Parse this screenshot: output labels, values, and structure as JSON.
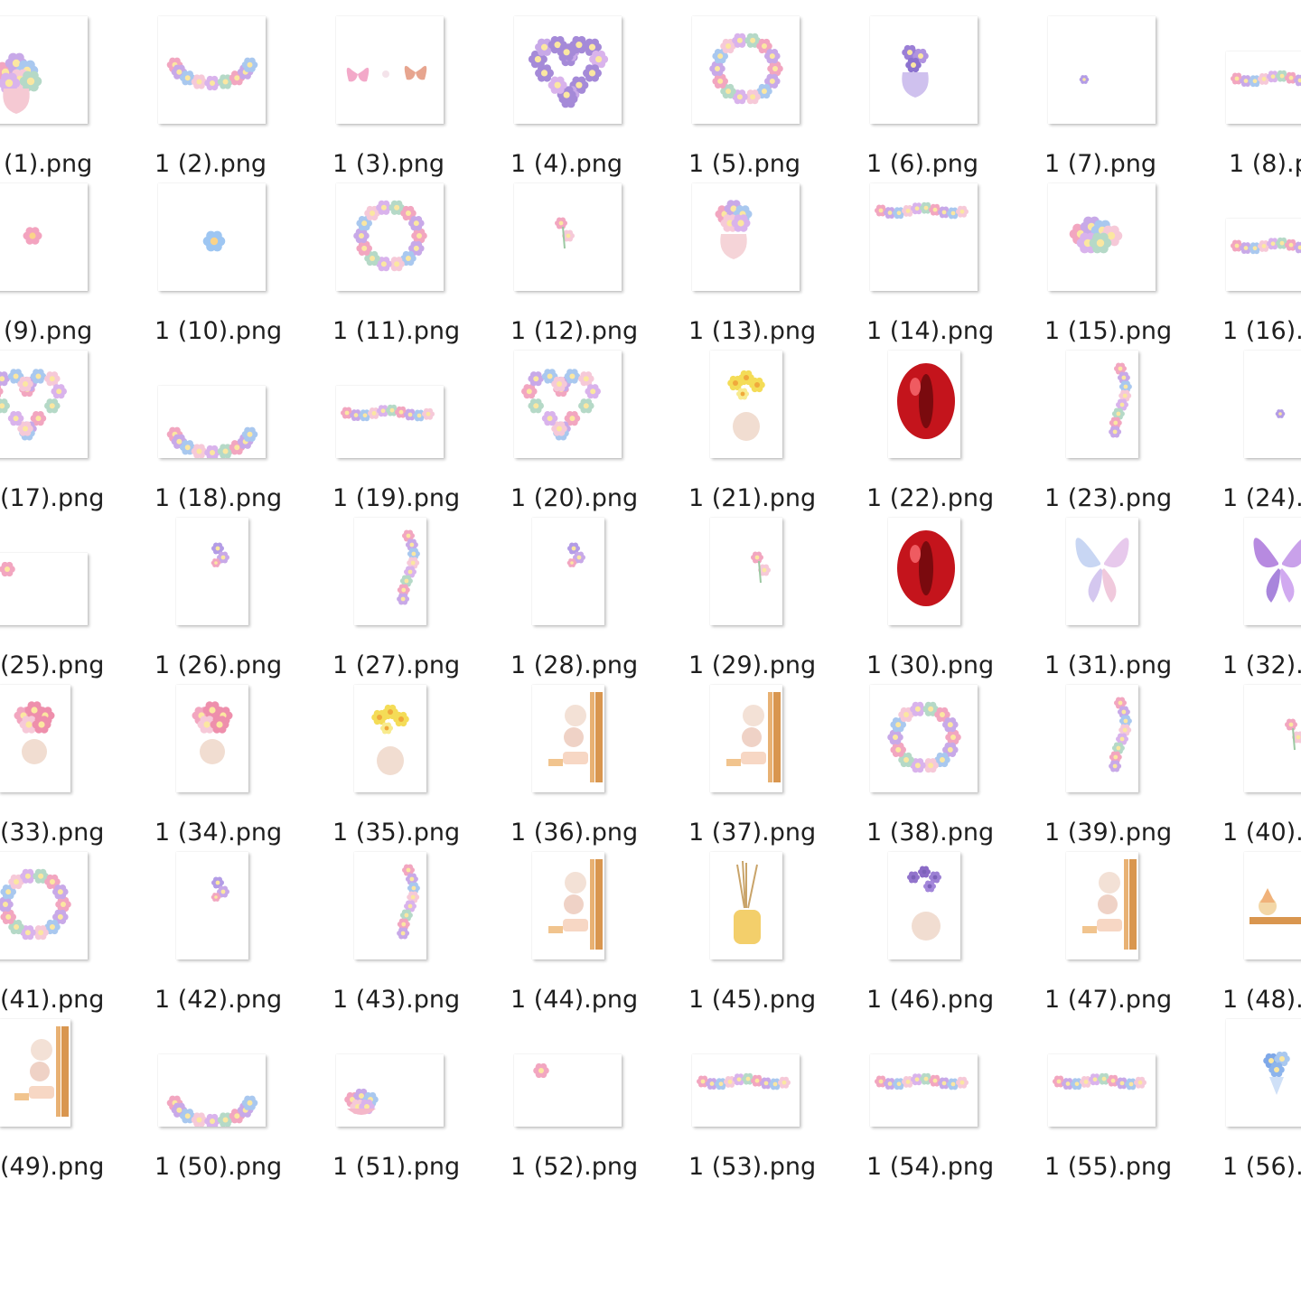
{
  "window": {
    "view": "large-icons"
  },
  "files": [
    {
      "label": "(1).png",
      "icon": "rose-bouquet-icon"
    },
    {
      "label": "1 (2).png",
      "icon": "floral-arc-icon"
    },
    {
      "label": "1 (3).png",
      "icon": "butterflies-icon"
    },
    {
      "label": "1 (4).png",
      "icon": "purple-heart-wreath-icon"
    },
    {
      "label": "1 (5).png",
      "icon": "floral-ring-icon"
    },
    {
      "label": "1 (6).png",
      "icon": "purple-bouquet-icon"
    },
    {
      "label": "1 (7).png",
      "icon": "tiny-flower-icon"
    },
    {
      "label": "1 (8).p",
      "icon": "floral-garland-icon"
    },
    {
      "label": "(9).png",
      "icon": "pink-flower-icon"
    },
    {
      "label": "1 (10).png",
      "icon": "blue-flower-icon"
    },
    {
      "label": "1 (11).png",
      "icon": "floral-ring-icon"
    },
    {
      "label": "1 (12).png",
      "icon": "pink-sprig-icon"
    },
    {
      "label": "1 (13).png",
      "icon": "flower-vase-icon"
    },
    {
      "label": "1 (14).png",
      "icon": "floral-garland-icon"
    },
    {
      "label": "1 (15).png",
      "icon": "flower-cluster-icon"
    },
    {
      "label": "1 (16).p",
      "icon": "floral-garland-icon"
    },
    {
      "label": "(17).png",
      "icon": "heart-wreath-icon"
    },
    {
      "label": "1 (18).png",
      "icon": "floral-arc-icon"
    },
    {
      "label": "1 (19).png",
      "icon": "floral-garland-icon"
    },
    {
      "label": "1 (20).png",
      "icon": "heart-wreath-icon"
    },
    {
      "label": "1 (21).png",
      "icon": "daffodil-vase-icon"
    },
    {
      "label": "1 (22).png",
      "icon": "red-lips-icon"
    },
    {
      "label": "1 (23).png",
      "icon": "floral-border-icon"
    },
    {
      "label": "1 (24).p",
      "icon": "tiny-flower-icon"
    },
    {
      "label": "(25).png",
      "icon": "corner-flower-icon"
    },
    {
      "label": "1 (26).png",
      "icon": "purple-sprig-icon"
    },
    {
      "label": "1 (27).png",
      "icon": "floral-border-icon"
    },
    {
      "label": "1 (28).png",
      "icon": "purple-sprig-icon"
    },
    {
      "label": "1 (29).png",
      "icon": "pink-sprig-icon"
    },
    {
      "label": "1 (30).png",
      "icon": "red-lips-icon"
    },
    {
      "label": "1 (31).png",
      "icon": "blue-butterfly-icon"
    },
    {
      "label": "1 (32).p",
      "icon": "purple-butterfly-icon"
    },
    {
      "label": "(33).png",
      "icon": "tulip-vase-icon"
    },
    {
      "label": "1 (34).png",
      "icon": "tulip-vase-icon"
    },
    {
      "label": "1 (35).png",
      "icon": "daffodil-vase-icon"
    },
    {
      "label": "1 (36).png",
      "icon": "spa-shelf-icon"
    },
    {
      "label": "1 (37).png",
      "icon": "spa-shelf-icon"
    },
    {
      "label": "1 (38).png",
      "icon": "floral-ring-icon"
    },
    {
      "label": "1 (39).png",
      "icon": "floral-border-icon"
    },
    {
      "label": "1 (40).p",
      "icon": "pink-sprig-icon"
    },
    {
      "label": "(41).png",
      "icon": "floral-ring-icon"
    },
    {
      "label": "1 (42).png",
      "icon": "purple-sprig-icon"
    },
    {
      "label": "1 (43).png",
      "icon": "floral-border-icon"
    },
    {
      "label": "1 (44).png",
      "icon": "spa-shelf-icon"
    },
    {
      "label": "1 (45).png",
      "icon": "reed-diffuser-icon"
    },
    {
      "label": "1 (46).png",
      "icon": "lavender-vase-icon"
    },
    {
      "label": "1 (47).png",
      "icon": "spa-shelf-icon"
    },
    {
      "label": "1 (48).p",
      "icon": "spa-tray-icon"
    },
    {
      "label": "(49).png",
      "icon": "spa-shelf-icon"
    },
    {
      "label": "1 (50).png",
      "icon": "floral-arc-icon"
    },
    {
      "label": "1 (51).png",
      "icon": "flower-basket-icon"
    },
    {
      "label": "1 (52).png",
      "icon": "corner-flower-icon"
    },
    {
      "label": "1 (53).png",
      "icon": "floral-garland-icon"
    },
    {
      "label": "1 (54).png",
      "icon": "floral-garland-icon"
    },
    {
      "label": "1 (55).png",
      "icon": "floral-garland-icon"
    },
    {
      "label": "1 (56).p",
      "icon": "blue-bouquet-icon"
    }
  ]
}
